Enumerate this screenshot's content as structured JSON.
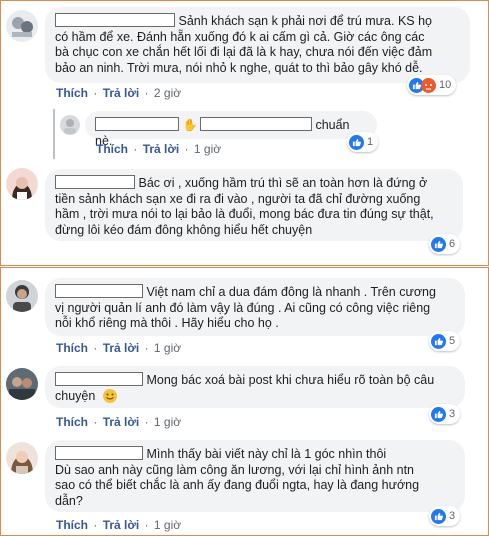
{
  "actions": {
    "like": "Thích",
    "reply": "Trả lời",
    "dot": "·"
  },
  "comments": [
    {
      "text_lines": [
        "Sảnh khách sạn k phải nơi để trú mưa. KS họ",
        "có hầm để xe. Đánh hẵn xuống đó k ai cấm gì cả. Giờ các ông các",
        "bà chục con xe chắn hết lối đi lại đã là k hay, chưa nói đến việc đảm",
        "bảo an ninh. Trời mưa, nói nhỏ k nghe, quát to thì bảo gây khó dễ."
      ],
      "time": "2 giờ",
      "reactions": "10"
    },
    {
      "text": "chuẩn nè.",
      "time": "1 giờ",
      "reactions": "1"
    },
    {
      "text_lines": [
        "Bác ơi , xuống hầm trú thì sẽ an toàn hơn là đứng ở",
        "tiền sảnh khách sạn xe đi ra đi vào , người ta đã chỉ đường xuống",
        "hầm , trời mưa nói to lại bảo là đuổi, mong bác đưa tin đúng sự thật,",
        "đừng lôi kéo đám đông không hiểu hết chuyện"
      ],
      "reactions": "6"
    },
    {
      "text_lines": [
        "Việt nam chỉ a dua đám đông là nhanh . Trên cương",
        "vị người quản lí anh đó làm vậy là đúng . Ai cũng có công việc riêng",
        "nỗi khổ riêng mà thôi . Hãy hiểu cho họ ."
      ],
      "time": "1 giờ",
      "reactions": "5"
    },
    {
      "text_lines": [
        "Mong bác xoá bài post khi chưa hiểu rõ toàn bộ câu",
        "chuyện"
      ],
      "time": "1 giờ",
      "reactions": "3"
    },
    {
      "text_lines": [
        "Mình thấy bài viết này chỉ là 1 góc nhìn thôi",
        "Dù sao anh này cũng làm công ăn lương, với lại chỉ hình ảnh ntn",
        "sao có thể biết chắc là anh ấy đang đuổi ngta, hay là đang hướng",
        "dẫn?"
      ],
      "time": "1 giờ",
      "reactions": "3"
    }
  ],
  "colors": {
    "link": "#385898",
    "bubble": "#f2f3f5",
    "like": "#2078f4",
    "angry": "#f0592a",
    "divider": "#e08a4a"
  },
  "icons": [
    "like-reaction-icon",
    "angry-reaction-icon",
    "wave-hand-icon",
    "smile-emoji-icon"
  ]
}
